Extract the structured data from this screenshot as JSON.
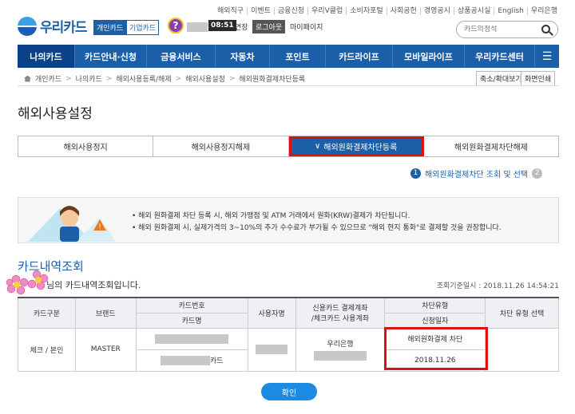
{
  "top_links": [
    "해외직구",
    "이벤트",
    "금융신청",
    "우리V클럽",
    "소비자포털",
    "사회공헌",
    "경영공시",
    "상품공시실",
    "English",
    "우리은행"
  ],
  "logo": "우리카드",
  "header": {
    "personal_tab": "개인카드",
    "corp_tab": "기업카드",
    "help_icon": "?",
    "timer": "08:51",
    "extend": "연장",
    "logout": "로그아웃",
    "mypage": "마이페이지",
    "search_placeholder": "카드의정석"
  },
  "nav": [
    "나의카드",
    "카드안내·신청",
    "금융서비스",
    "자동차",
    "포인트",
    "카드라이프",
    "모바일라이프",
    "우리카드센터"
  ],
  "breadcrumb": [
    "개인카드",
    "나의카드",
    "해외사용등록/해제",
    "해외사용설정",
    "해외원화결제차단등록"
  ],
  "breadcrumb_buttons": {
    "zoom": "축소/확대보기",
    "print": "화면인쇄"
  },
  "page_title": "해외사용설정",
  "tabs": [
    "해외사용정지",
    "해외사용정지해제",
    "해외원화결제차단등록",
    "해외원화결제차단해제"
  ],
  "active_tab_marker": "∨",
  "step": {
    "num1": "1",
    "label": "해외원화결제차단 조회 및 선택",
    "num2": "2"
  },
  "notice": [
    "• 해외 원화결제 차단 등록 시, 해외 가맹점 및 ATM 거래에서 원화(KRW)결제가 차단됩니다.",
    "• 해외 원화결제 시, 실제가격의 3~10%의 추가 수수료가 부가될 수 있으므로 \"해외 현지 통화\"로 결제할 것을 권장합니다."
  ],
  "section_title": "카드내역조회",
  "subtitle": "님의 카드내역조회입니다.",
  "base_date": "조회기준일시 : 2018.11.26 14:54:21",
  "table": {
    "headers": {
      "card_type": "카드구분",
      "brand": "브랜드",
      "card_no": "카드번호",
      "card_name": "카드명",
      "user": "사용자명",
      "account": "신용카드 결제계좌",
      "account2": "/체크카드 사용계좌",
      "block_type": "차단유형",
      "reg_date": "신청일자",
      "select": "차단 유형 선택"
    },
    "row": {
      "card_type": "체크 / 본인",
      "brand": "MASTER",
      "card_suffix": "카드",
      "bank": "우리은행",
      "block_type": "해외원화결제 차단",
      "reg_date": "2018.11.26"
    }
  },
  "confirm": "확인"
}
